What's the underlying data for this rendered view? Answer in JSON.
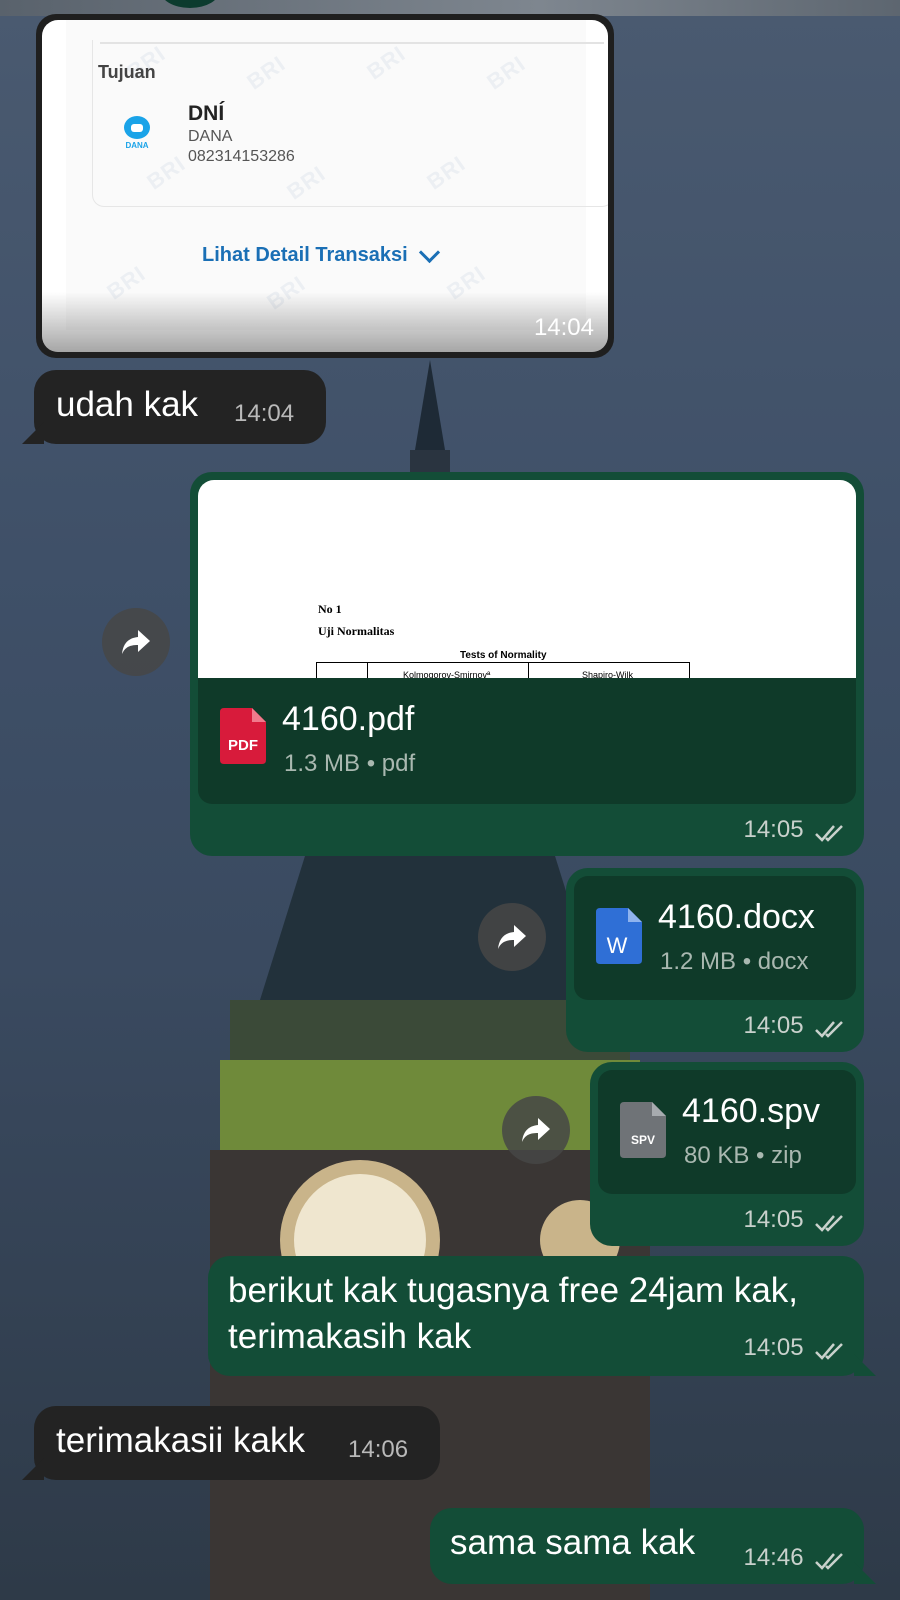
{
  "receipt": {
    "section_label": "Tujuan",
    "name": "DNÍ",
    "wallet_logo_text": "DANA",
    "bank": "DANA",
    "phone": "082314153286",
    "link": "Lihat Detail Transaksi",
    "time": "14:04",
    "watermark": "BRI"
  },
  "messages": [
    {
      "text": "udah kak",
      "time": "14:04"
    },
    {
      "file_name": "4160.pdf",
      "file_meta": "1.3 MB • pdf",
      "icon_label": "PDF",
      "time": "14:05",
      "preview": {
        "line1": "No 1",
        "line2": "Uji Normalitas",
        "line3": "Tests of Normality",
        "col1": "Kolmogorov-Smirnovª",
        "col2": "Shapiro-Wilk"
      }
    },
    {
      "file_name": "4160.docx",
      "file_meta": "1.2 MB • docx",
      "icon_label": "W",
      "time": "14:05"
    },
    {
      "file_name": "4160.spv",
      "file_meta": "80 KB • zip",
      "icon_label": "SPV",
      "time": "14:05"
    },
    {
      "text_line1": "berikut kak tugasnya free 24jam kak,",
      "text_line2": "terimakasih kak",
      "time": "14:05"
    },
    {
      "text": "terimakasii kakk",
      "time": "14:06"
    },
    {
      "text": "sama sama kak",
      "time": "14:46"
    }
  ],
  "colors": {
    "incoming_bubble": "#232323",
    "outgoing_bubble": "#134d37",
    "file_row": "#0f3a29",
    "pdf_icon": "#d81b3b",
    "word_icon": "#2f6fd6",
    "spv_icon": "#6f7377"
  }
}
